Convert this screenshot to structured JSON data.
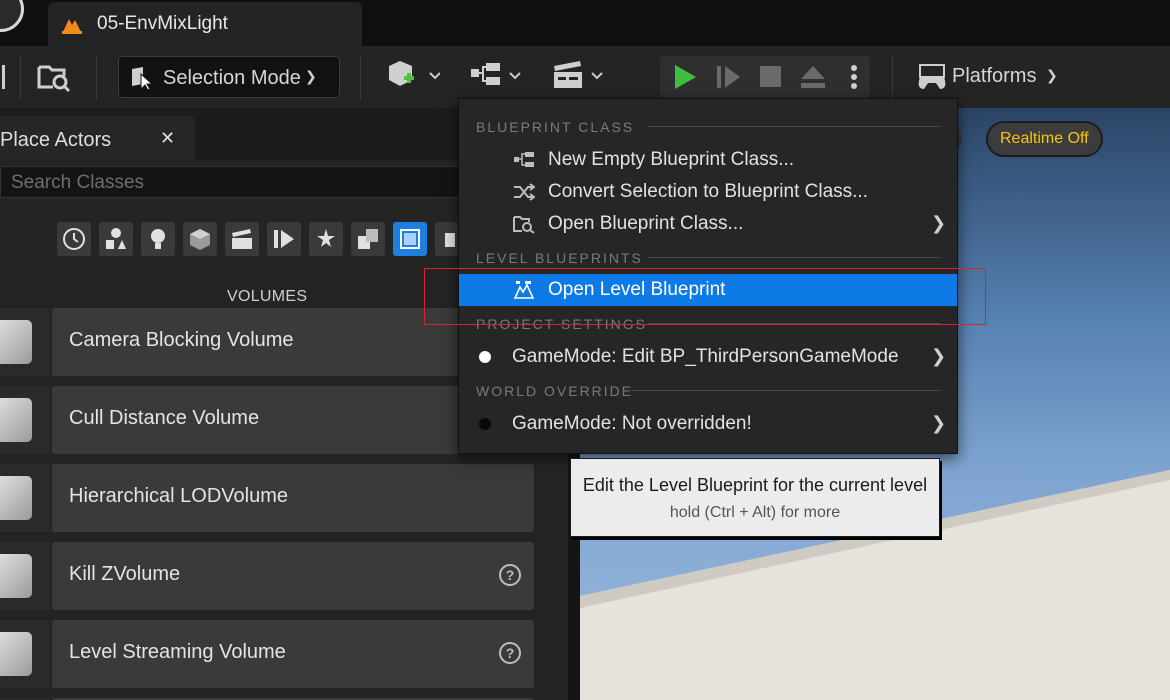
{
  "document_tab": {
    "title": "05-EnvMixLight"
  },
  "toolbar": {
    "selection_mode_label": "Selection Mode",
    "platforms_label": "Platforms"
  },
  "place_actors": {
    "tab_label": "Place Actors",
    "search_placeholder": "Search Classes",
    "category_icons": [
      "recent-icon",
      "basic-shapes-icon",
      "lights-icon",
      "shapes-icon",
      "cinematic-icon",
      "visual-effects-icon",
      "geometry-icon",
      "all-classes-icon",
      "volumes-icon",
      "more-icon"
    ],
    "section_title": "VOLUMES",
    "items": [
      {
        "label": "Camera Blocking Volume",
        "icon": "camera-volume-icon",
        "help": false
      },
      {
        "label": "Cull Distance Volume",
        "icon": "eye-volume-icon",
        "help": false
      },
      {
        "label": "Hierarchical LODVolume",
        "icon": "lod-volume-icon",
        "help": false
      },
      {
        "label": "Kill ZVolume",
        "icon": "skull-volume-icon",
        "help": true
      },
      {
        "label": "Level Streaming Volume",
        "icon": "streaming-volume-icon",
        "help": true
      }
    ]
  },
  "viewport": {
    "realtime_label": "Realtime Off"
  },
  "blueprint_menu": {
    "blueprint_class_header": "BLUEPRINT CLASS",
    "new_empty_label": "New Empty Blueprint Class...",
    "convert_label": "Convert Selection to Blueprint Class...",
    "open_class_label": "Open Blueprint Class...",
    "level_blueprints_header": "LEVEL BLUEPRINTS",
    "open_level_label": "Open Level Blueprint",
    "project_settings_header": "PROJECT SETTINGS",
    "gamemode_edit_label": "GameMode: Edit BP_ThirdPersonGameMode",
    "world_override_header": "WORLD OVERRIDE",
    "gamemode_override_label": "GameMode: Not overridden!"
  },
  "tooltip": {
    "title": "Edit the Level Blueprint for the current level",
    "hint": "hold (Ctrl + Alt) for more"
  },
  "colors": {
    "highlight": "#0d7ae6",
    "realtime_text": "#f3c514",
    "annotation_outline": "#d9232a",
    "play_green": "#3fbf3f"
  }
}
